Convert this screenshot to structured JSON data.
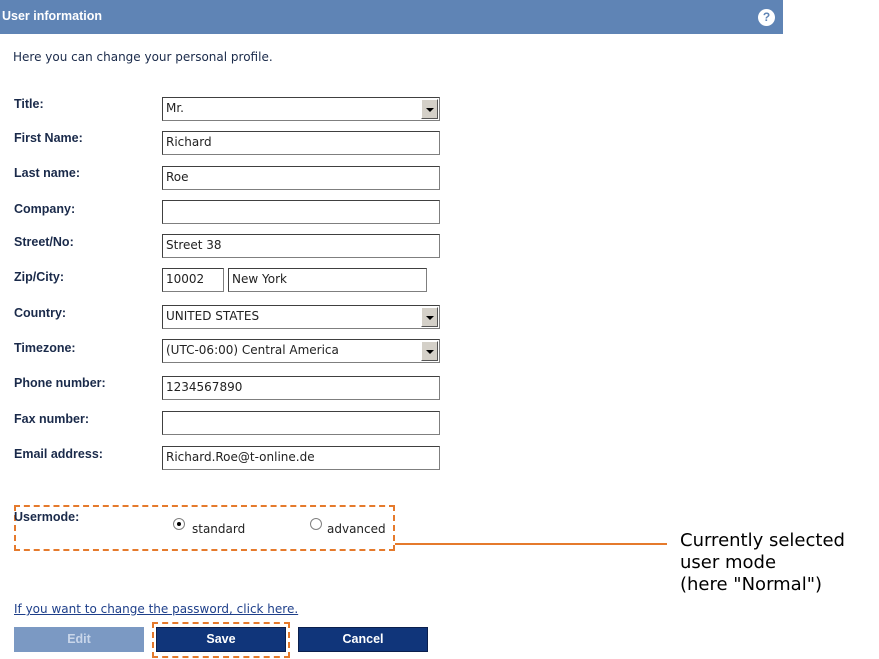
{
  "header": {
    "title": "User information",
    "help_icon": "question-icon"
  },
  "intro": "Here you can change your personal profile.",
  "fields": {
    "title": {
      "label": "Title:",
      "value": "Mr."
    },
    "first_name": {
      "label": "First Name:",
      "value": "Richard"
    },
    "last_name": {
      "label": "Last name:",
      "value": "Roe"
    },
    "company": {
      "label": "Company:",
      "value": ""
    },
    "street": {
      "label": "Street/No:",
      "value": "Street 38"
    },
    "zip_city": {
      "label": "Zip/City:",
      "zip": "10002",
      "city": "New York"
    },
    "country": {
      "label": "Country:",
      "value": "UNITED STATES"
    },
    "timezone": {
      "label": "Timezone:",
      "value": "(UTC-06:00) Central America"
    },
    "phone": {
      "label": "Phone number:",
      "value": "1234567890"
    },
    "fax": {
      "label": "Fax number:",
      "value": ""
    },
    "email": {
      "label": "Email address:",
      "value": "Richard.Roe@t-online.de"
    }
  },
  "usermode": {
    "label": "Usermode:",
    "options": [
      {
        "label": "standard",
        "checked": true
      },
      {
        "label": "advanced",
        "checked": false
      }
    ]
  },
  "password_link": "If you want to change the password, click here.",
  "buttons": {
    "edit": "Edit",
    "save": "Save",
    "cancel": "Cancel"
  },
  "callout": {
    "line1": "Currently selected",
    "line2": "user mode",
    "line3": "(here \"Normal\")"
  },
  "colors": {
    "header": "#5f84b5",
    "button": "#10357a",
    "highlight": "#e57a2c"
  }
}
